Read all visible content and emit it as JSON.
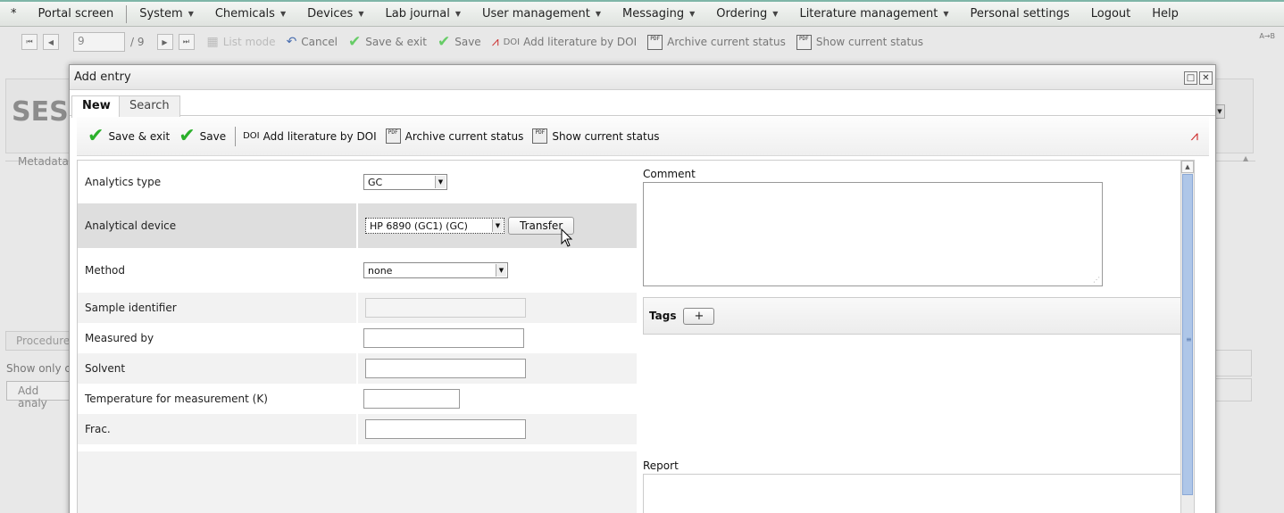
{
  "menu": {
    "items": [
      {
        "label": "*",
        "caret": false
      },
      {
        "label": "Portal screen",
        "caret": false
      },
      {
        "label": "System",
        "caret": true
      },
      {
        "label": "Chemicals",
        "caret": true
      },
      {
        "label": "Devices",
        "caret": true
      },
      {
        "label": "Lab journal",
        "caret": true
      },
      {
        "label": "User management",
        "caret": true
      },
      {
        "label": "Messaging",
        "caret": true
      },
      {
        "label": "Ordering",
        "caret": true
      },
      {
        "label": "Literature management",
        "caret": true
      },
      {
        "label": "Personal settings",
        "caret": false
      },
      {
        "label": "Logout",
        "caret": false
      },
      {
        "label": "Help",
        "caret": false
      }
    ]
  },
  "bg_toolbar": {
    "page_value": "9",
    "page_total": "/ 9",
    "list_mode": "List mode",
    "cancel": "Cancel",
    "save_exit": "Save & exit",
    "save": "Save",
    "doi_tag": "DOI",
    "add_doi": "Add literature by DOI",
    "archive": "Archive current status",
    "show": "Show current status",
    "az": "A→B"
  },
  "bg_page": {
    "ses": "SES",
    "metadata": "Metadata",
    "procedure": "Procedure",
    "show_only": "Show only c",
    "add_analy": "Add analy"
  },
  "dialog": {
    "title": "Add entry",
    "tabs": {
      "new": "New",
      "search": "Search"
    },
    "toolbar": {
      "save_exit": "Save & exit",
      "save": "Save",
      "doi_tag": "DOI",
      "add_doi": "Add literature by DOI",
      "archive": "Archive current status",
      "show": "Show current status"
    },
    "form": {
      "analytics_type": {
        "label": "Analytics type",
        "value": "GC"
      },
      "analytical_device": {
        "label": "Analytical device",
        "value": "HP 6890 (GC1) (GC)",
        "button": "Transfer"
      },
      "method": {
        "label": "Method",
        "value": "none"
      },
      "sample_identifier": {
        "label": "Sample identifier",
        "value": ""
      },
      "measured_by": {
        "label": "Measured by",
        "value": ""
      },
      "solvent": {
        "label": "Solvent",
        "value": ""
      },
      "temperature": {
        "label": "Temperature for measurement (K)",
        "value": ""
      },
      "frac": {
        "label": "Frac.",
        "value": ""
      }
    },
    "comment_label": "Comment",
    "tags_label": "Tags",
    "tags_add": "+",
    "report_label": "Report"
  },
  "colors": {
    "accent": "#7fb6a8",
    "check": "#2bb02b",
    "scroll_thumb": "#aec6e8"
  }
}
